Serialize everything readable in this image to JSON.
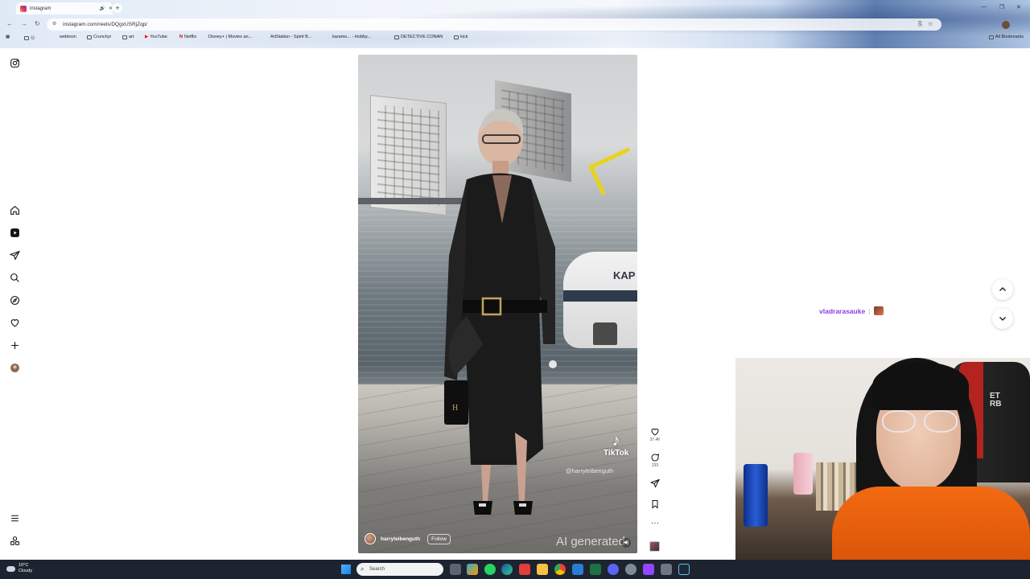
{
  "browser": {
    "tab_title": "instagram",
    "url": "instagram.com/reels/DQgxUSRjZqp/",
    "bookmarks": [
      "Ⓤ",
      "webtoon",
      "Crunchyr",
      "art",
      "YouTube",
      "Netflix",
      "Disney+ | Movies an...",
      "ArtStation - Spirit B...",
      "karamo... - Hobby...",
      "DETECTIVE CONAN",
      "kick"
    ],
    "all_bookmarks": "All Bookmarks"
  },
  "sidebar": {
    "items": [
      {
        "name": "instagram-logo-icon"
      },
      {
        "name": "home-icon"
      },
      {
        "name": "reels-icon"
      },
      {
        "name": "direct-messages-icon"
      },
      {
        "name": "search-icon"
      },
      {
        "name": "explore-icon"
      },
      {
        "name": "notifications-heart-icon"
      },
      {
        "name": "create-plus-icon"
      },
      {
        "name": "profile-avatar"
      },
      {
        "name": "more-menu-icon"
      },
      {
        "name": "also-from-meta-icon"
      }
    ]
  },
  "reel": {
    "author": "harryleibenguth",
    "follow_label": "Follow",
    "tiktok_label": "TikTok",
    "tiktok_handle": "@harryleibenguth",
    "ai_label": "AI generated",
    "boat_text": "KAP",
    "likes": "37.4K",
    "comments": "233"
  },
  "chat": {
    "username": "vladrarasauke",
    "separator": ":"
  },
  "webcam": {
    "chair_text": "ET\nRB"
  },
  "taskbar": {
    "temperature": "10°C",
    "condition": "Cloudy",
    "search_placeholder": "Search"
  },
  "colors": {
    "chat_username": "#8a3fe0",
    "taskbar_bg": "#1d2430"
  }
}
